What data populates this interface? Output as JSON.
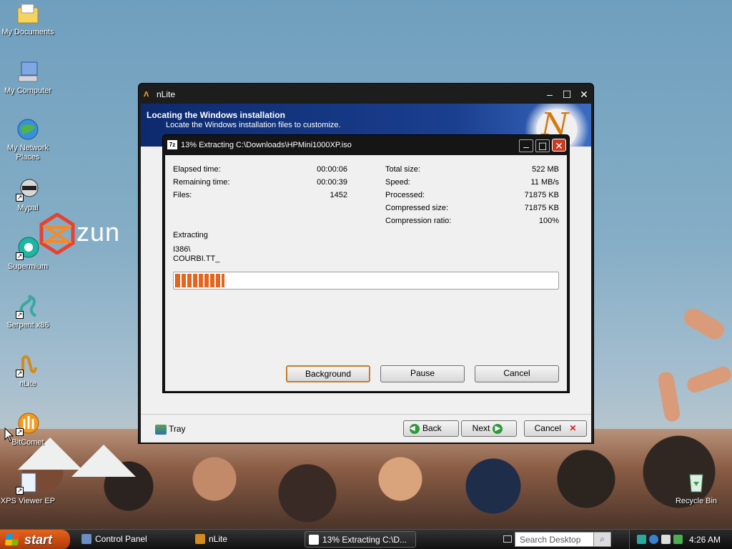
{
  "desktop": {
    "icons": [
      {
        "label": "My Documents",
        "icon": "folder-icon"
      },
      {
        "label": "My Computer",
        "icon": "computer-icon"
      },
      {
        "label": "My Network Places",
        "icon": "network-icon"
      },
      {
        "label": "Mypal",
        "icon": "raccoon-browser-icon"
      },
      {
        "label": "Supermium",
        "icon": "browser-icon"
      },
      {
        "label": "Serpent x86",
        "icon": "serpent-icon"
      },
      {
        "label": "nLite",
        "icon": "nlite-icon"
      },
      {
        "label": "BitComet",
        "icon": "bitcomet-icon"
      },
      {
        "label": "XPS Viewer EP",
        "icon": "xps-viewer-icon"
      },
      {
        "label": "Recycle Bin",
        "icon": "recycle-bin-icon"
      }
    ],
    "wallpaper_logo": "zun"
  },
  "nlite": {
    "title": "nLite",
    "header_title": "Locating the Windows installation",
    "header_subtitle": "Locate the Windows installation files to customize.",
    "tray_label": "Tray",
    "back_label": "Back",
    "next_label": "Next",
    "cancel_label": "Cancel"
  },
  "zip": {
    "title": "13% Extracting C:\\Downloads\\HPMini1000XP.iso",
    "left_stats": [
      {
        "label": "Elapsed time:",
        "value": "00:00:06"
      },
      {
        "label": "Remaining time:",
        "value": "00:00:39"
      },
      {
        "label": "Files:",
        "value": "1452"
      }
    ],
    "right_stats": [
      {
        "label": "Total size:",
        "value": "522 MB"
      },
      {
        "label": "Speed:",
        "value": "11 MB/s"
      },
      {
        "label": "Processed:",
        "value": "71875 KB"
      },
      {
        "label": "Compressed size:",
        "value": "71875 KB"
      },
      {
        "label": "Compression ratio:",
        "value": "100%"
      }
    ],
    "status_label": "Extracting",
    "current_dir": "I386\\",
    "current_file": "COURBI.TT_",
    "progress_percent": 13,
    "background_label": "Background",
    "pause_label": "Pause",
    "cancel_label": "Cancel"
  },
  "taskbar": {
    "start_label": "start",
    "tasks": [
      "Control Panel",
      "nLite",
      "13% Extracting C:\\D..."
    ],
    "search_placeholder": "Search Desktop",
    "clock": "4:26 AM"
  },
  "colors": {
    "progress": "#e5651f",
    "start_button": "#d9531a",
    "nlite_header": "#1b3f8f"
  }
}
